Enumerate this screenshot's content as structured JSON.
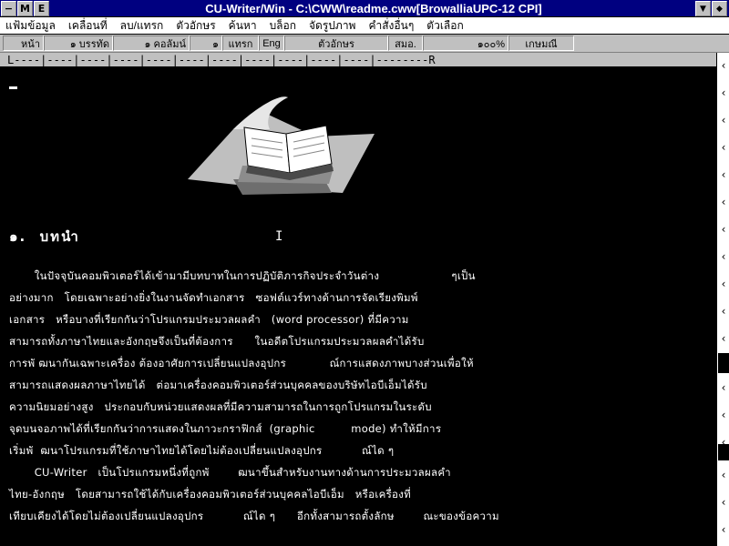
{
  "window": {
    "title": "CU-Writer/Win - C:\\CWW\\readme.cww[BrowalliaUPC-12 CPI]"
  },
  "menu": [
    "แฟ้มข้อมูล",
    "เคลื่อนที่",
    "ลบ/แทรก",
    "ตัวอักษร",
    "ค้นหา",
    "บล็อก",
    "จัดรูปภาพ",
    "คำสั่งอื่นๆ",
    "ตัวเลือก"
  ],
  "status": {
    "page": "หน้า",
    "line": "๑ บรรทัด",
    "column": "๑ คอลัมน์",
    "num": "๑",
    "insert": "แทรก",
    "lang": "Eng",
    "font": "ตัวอักษร",
    "align": "สมอ.",
    "zoom": "๑๐๐%",
    "mode": "เกษมณี"
  },
  "ruler": "L----|----|----|----|----|----|----|----|----|----|----|--------R",
  "document": {
    "heading": "๑.  บทนำ",
    "lines": [
      "       ในปัจจุบันคอมพิวเตอร์ได้เข้ามามีบทบาทในการปฏิบัติภารกิจประจำวันต่าง                    ๆเป็น",
      "อย่างมาก   โดยเฉพาะอย่างยิ่งในงานจัดทำเอกสาร   ซอฟต์แวร์ทางด้านการจัดเรียงพิมพ์",
      "เอกสาร   หรือบางที่เรียกกันว่าโปรแกรมประมวลผลคำ   (word processor) ที่มีความ",
      "สามารถทั้งภาษาไทยและอังกฤษจึงเป็นที่ต้องการ      ในอดีตโปรแกรมประมวลผลคำได้รับ",
      "การพั ฒนากันเฉพาะเครื่อง ต้องอาศัยการเปลี่ยนแปลงอุปกร            ณ์การแสดงภาพบางส่วนเพื่อให้",
      "สามารถแสดงผลภาษาไทยได้   ต่อมาเครื่องคอมพิวเตอร์ส่วนบุคคลของบริษัทไอบีเอ็มได้รับ",
      "ความนิยมอย่างสูง   ประกอบกับหน่วยแสดงผลที่มีความสามารถในการถูกโปรแกรมในระดับ",
      "จุดบนจอภาพได้ที่เรียกกันว่าการแสดงในภาวะกราฟิกส์  (graphic          mode) ทำให้มีการ",
      "เริ่มพั  ฒนาโปรแกรมที่ใช้ภาษาไทยได้โดยไม่ต้องเปลี่ยนแปลงอุปกร           ณ์ได ๆ",
      "       CU-Writer   เป็นโปรแกรมหนึ่งที่ถูกพั        ฒนาขึ้นสำหรับงานทางด้านการประมวลผลคำ",
      "ไทย-อังกฤษ   โดยสามารถใช้ได้กับเครื่องคอมพิวเตอร์ส่วนบุคคลไอบีเอ็ม   หรือเครื่องที่",
      "เทียบเคียงได้โดยไม่ต้องเปลี่ยนแปลงอุปกร           ณ์ได ๆ      อีกทั้งสามารถตั้งลักษ        ณะของข้อความ"
    ]
  },
  "icons": {
    "system_menu": "minus-box-icon",
    "app": "document-icon",
    "scroll_up": "up-arrow-icon",
    "scroll_down": "down-arrow-icon",
    "right_toolbar": "chevron-left-icon"
  }
}
